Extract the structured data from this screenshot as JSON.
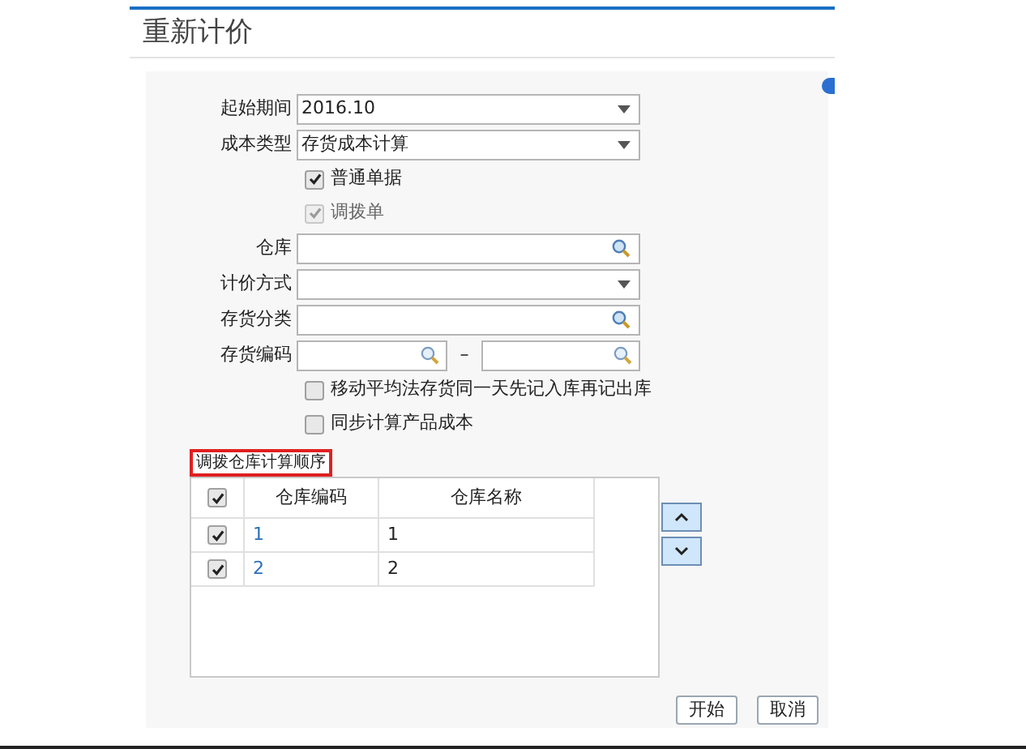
{
  "window": {
    "title": "重新计价"
  },
  "form": [
    {
      "kind": "dropdown",
      "label": "起始期间",
      "value": "2016.10"
    },
    {
      "kind": "dropdown",
      "label": "成本类型",
      "value": "存货成本计算"
    },
    {
      "kind": "checkbox",
      "label": "普通单据",
      "checked": true,
      "disabled": false
    },
    {
      "kind": "checkbox",
      "label": "调拨单",
      "checked": true,
      "disabled": true
    },
    {
      "kind": "lookup",
      "label": "仓库"
    },
    {
      "kind": "dropdown",
      "label": "计价方式"
    },
    {
      "kind": "lookup",
      "label": "存货分类"
    },
    {
      "kind": "range",
      "label": "存货编码",
      "separator": "–"
    },
    {
      "kind": "checkbox",
      "label": "移动平均法存货同一天先记入库再记出库",
      "checked": false,
      "disabled": false
    },
    {
      "kind": "checkbox",
      "label": "同步计算产品成本",
      "checked": false,
      "disabled": false
    }
  ],
  "order_table": {
    "title": "调拨仓库计算顺序",
    "header_checked": true,
    "columns": [
      "仓库编码",
      "仓库名称"
    ],
    "rows": [
      {
        "checked": true,
        "cells": [
          "1",
          "1"
        ]
      },
      {
        "checked": true,
        "cells": [
          "2",
          "2"
        ]
      }
    ]
  },
  "buttons": [
    "开始",
    "取消"
  ]
}
